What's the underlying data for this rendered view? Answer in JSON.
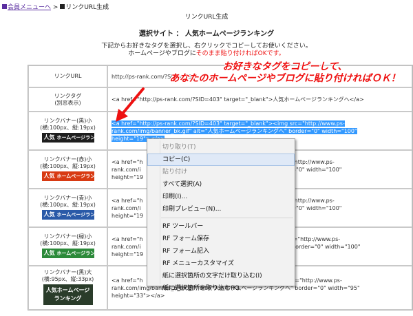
{
  "breadcrumb": {
    "back_label": "会員メニューへ",
    "separator": ">",
    "current_label": "リンクURL生成"
  },
  "page": {
    "title": "リンクURL生成",
    "site_label": "選択サイト ： 人気ホームページランキング",
    "intro_line1": "下記からお好きなタグを選択し、右クリックでコピーしてお使いください。",
    "intro_line2_prefix": "ホームページやブログに",
    "intro_line2_highlight": "そのまま貼り付ければOKです。"
  },
  "callout": {
    "line1": "お好きなタグをコピーして、",
    "line2": "あなたのホームページやブログに貼り付ければＯＫ！",
    "color": "#ee1111"
  },
  "rows": {
    "url": {
      "label": "リンクURL",
      "value": "http://ps-rank.com/?SID=403"
    },
    "tag": {
      "label1": "リンクタグ",
      "label2": "(別窓表示)",
      "value": "<a href=\"http://ps-rank.com/?SID=403\" target=\"_blank\">人気ホームページランキングへ</a>"
    },
    "banner_black_small": {
      "label1": "リンクバナー(黒)小",
      "label2": "(横:100px、縦:19px)",
      "banner_text_a": "人気",
      "banner_text_b": "ホームページランキング",
      "code_line1": "<a href=\"http://ps-rank.com/?SID=403\" target=\"_blank\"><img src=\"http://www.ps-",
      "code_line2": "rank.com/img/banner_bk.gif\" alt=\"人気ホームページランキングへ\" border=\"0\" width=\"100\"",
      "code_line3": "height=\"19\"></a>"
    },
    "banner_red_small": {
      "label1": "リンクバナー(赤)小",
      "label2": "(横:100px、縦:19px)",
      "banner_text_a": "人気",
      "banner_text_b": "ホームページランキング",
      "code_line1_a": "<a href=\"h",
      "code_line1_b": "\"http://www.ps-",
      "code_line2_a": "rank.com/i",
      "code_line2_b": "border=\"0\" width=\"100\"",
      "code_line3": "height=\"19"
    },
    "banner_blue_small": {
      "label1": "リンクバナー(青)小",
      "label2": "(横:100px、縦:19px)",
      "banner_text_a": "人気",
      "banner_text_b": "ホームページランキング",
      "code_line1_a": "<a href=\"h",
      "code_line1_b": "\"http://www.ps-",
      "code_line2_a": "rank.com/i",
      "code_line2_b": "border=\"0\" width=\"100\"",
      "code_line3": "height=\"19"
    },
    "banner_green_small": {
      "label1": "リンクバナー(緑)小",
      "label2": "(横:100px、縦:19px)",
      "banner_text_a": "人気",
      "banner_text_b": "ホームページランキング",
      "code_line1_a": "<a href=\"h",
      "code_line1_b": "src=\"http://www.ps-",
      "code_line2_a": "rank.com/i",
      "code_line2_b": "border=\"0\" width=\"100\"",
      "code_line3": "height=\"19"
    },
    "banner_black_large": {
      "label1": "リンクバナー(黒)大",
      "label2": "(横:95px、縦:33px)",
      "banner_line1": "人気ホームページ",
      "banner_line2": "ランキング",
      "code_line1_a": "<a href=\"h",
      "code_line1_b": "c=\"http://www.ps-",
      "code_line2": "rank.com/img/banner_b_bk.gif\" alt=\"人気ホームページランキングへ\" border=\"0\" width=\"95\"",
      "code_line3": "height=\"33\"></a>"
    }
  },
  "context_menu": {
    "items": [
      {
        "label": "切り取り(T)",
        "enabled": false
      },
      {
        "label": "コピー(C)",
        "enabled": true,
        "highlighted": true
      },
      {
        "label": "貼り付け",
        "enabled": false
      },
      {
        "label": "すべて選択(A)",
        "enabled": true
      },
      {
        "label": "印刷(I)...",
        "enabled": true
      },
      {
        "label": "印刷プレビュー(N)...",
        "enabled": true
      },
      {
        "label": "RF ツールバー",
        "enabled": true
      },
      {
        "label": "RF フォーム保存",
        "enabled": true
      },
      {
        "label": "RF フォーム記入",
        "enabled": true
      },
      {
        "label": "RF メニューカスタマイズ",
        "enabled": true
      },
      {
        "label": "紙に選択箇所の文字だけ取り込む(I)",
        "enabled": true
      },
      {
        "label": "紙に選択箇所を取り込む(K)",
        "enabled": true
      }
    ]
  },
  "colors": {
    "selection": "#3399ff",
    "link": "#5a2ea0",
    "alert_red": "#ee1111",
    "menu_highlight": "#dfe9f7"
  }
}
